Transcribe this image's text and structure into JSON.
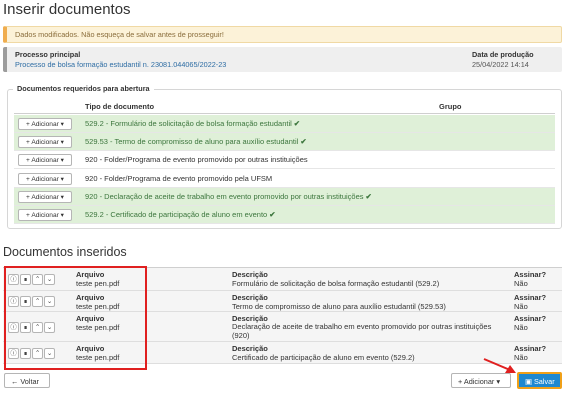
{
  "page_title": "Inserir documentos",
  "alert_message": "Dados modificados. Não esqueça de salvar antes de prosseguir!",
  "process": {
    "label": "Processo principal",
    "value": "Processo de bolsa formação estudantil n. 23081.044065/2022-23",
    "date_label": "Data de produção",
    "date_value": "25/04/2022 14:14"
  },
  "required": {
    "legend": "Documentos requeridos para abertura",
    "col_type": "Tipo de documento",
    "col_group": "Grupo",
    "add_label": "Adicionar",
    "rows": [
      {
        "doc": "529.2 - Formulário de solicitação de bolsa formação estudantil",
        "done": true
      },
      {
        "doc": "529.53 - Termo de compromisso de aluno para auxílio estudantil",
        "done": true
      },
      {
        "doc": "920 - Folder/Programa de evento promovido por outras instituições",
        "done": false
      },
      {
        "doc": "920 - Folder/Programa de evento promovido pela UFSM",
        "done": false
      },
      {
        "doc": "920 - Declaração de aceite de trabalho em evento promovido por outras instituições",
        "done": true
      },
      {
        "doc": "529.2 - Certificado de participação de aluno em evento",
        "done": true
      }
    ]
  },
  "inserted": {
    "title": "Documentos inseridos",
    "h_file": "Arquivo",
    "h_desc": "Descrição",
    "h_sign": "Assinar?",
    "rows": [
      {
        "file": "teste pen.pdf",
        "desc": "Formulário de solicitação de bolsa formação estudantil (529.2)",
        "sign": "Não"
      },
      {
        "file": "teste pen.pdf",
        "desc": "Termo de compromisso de aluno para auxílio estudantil (529.53)",
        "sign": "Não"
      },
      {
        "file": "teste pen.pdf",
        "desc": "Declaração de aceite de trabalho em evento promovido por outras instituições (920)",
        "sign": "Não"
      },
      {
        "file": "teste pen.pdf",
        "desc": "Certificado de participação de aluno em evento (529.2)",
        "sign": "Não"
      }
    ]
  },
  "footer": {
    "back_label": "Voltar",
    "add_label": "Adicionar",
    "save_label": "Salvar"
  },
  "colors": {
    "success_bg": "#dff0d8",
    "warning_bg": "#fcf2d8",
    "primary": "#1e88d0",
    "highlight": "#e02020"
  }
}
